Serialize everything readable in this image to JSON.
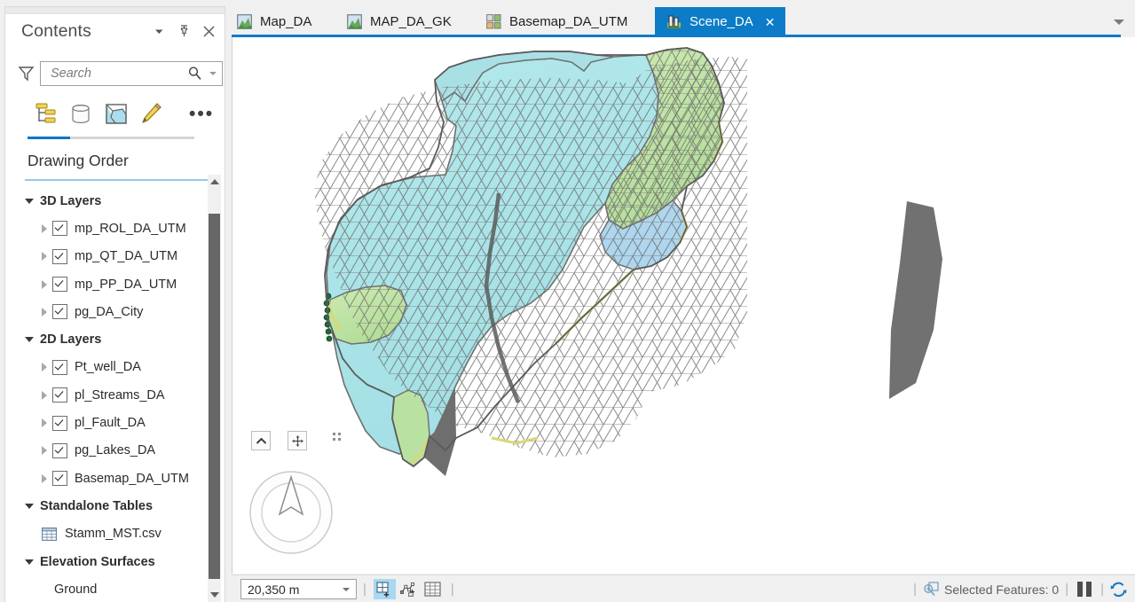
{
  "contents_pane": {
    "title": "Contents",
    "header_buttons": [
      {
        "name": "menu-caret-icon",
        "glyph": "caret-down"
      },
      {
        "name": "pin-icon",
        "glyph": "pin"
      },
      {
        "name": "close-icon",
        "glyph": "close"
      }
    ],
    "search": {
      "placeholder": "Search",
      "value": "",
      "filter_icon": "filter-funnel-icon",
      "magnifier_icon": "search-icon",
      "dropdown_icon": "chevron-down-icon"
    },
    "view_tabs": [
      {
        "name": "list-by-drawing-order-icon",
        "label": "List By Drawing Order",
        "active": true
      },
      {
        "name": "list-by-data-source-icon",
        "label": "List By Data Source",
        "active": false
      },
      {
        "name": "list-by-selection-icon",
        "label": "List By Selection",
        "active": false
      },
      {
        "name": "list-by-editing-icon",
        "label": "List By Editing",
        "active": false
      },
      {
        "name": "more-options-icon",
        "label": "•••",
        "active": false
      }
    ],
    "section_title": "Drawing Order",
    "tree": [
      {
        "type": "group",
        "label": "3D Layers",
        "expanded": true
      },
      {
        "type": "layer",
        "label": "mp_ROL_DA_UTM",
        "checked": true
      },
      {
        "type": "layer",
        "label": "mp_QT_DA_UTM",
        "checked": true
      },
      {
        "type": "layer",
        "label": "mp_PP_DA_UTM",
        "checked": true
      },
      {
        "type": "layer",
        "label": "pg_DA_City",
        "checked": true
      },
      {
        "type": "group",
        "label": "2D Layers",
        "expanded": true
      },
      {
        "type": "layer",
        "label": "Pt_well_DA",
        "checked": true
      },
      {
        "type": "layer",
        "label": "pl_Streams_DA",
        "checked": true
      },
      {
        "type": "layer",
        "label": "pl_Fault_DA",
        "checked": true
      },
      {
        "type": "layer",
        "label": "pg_Lakes_DA",
        "checked": true
      },
      {
        "type": "layer",
        "label": "Basemap_DA_UTM",
        "checked": true
      },
      {
        "type": "group",
        "label": "Standalone Tables",
        "expanded": true
      },
      {
        "type": "table",
        "label": "Stamm_MST.csv"
      },
      {
        "type": "group",
        "label": "Elevation Surfaces",
        "expanded": true
      },
      {
        "type": "plain",
        "label": "Ground"
      }
    ]
  },
  "tabbar": {
    "tabs": [
      {
        "label": "Map_DA",
        "icon": "map-view-icon",
        "active": false,
        "closable": false
      },
      {
        "label": "MAP_DA_GK",
        "icon": "map-view-icon",
        "active": false,
        "closable": false
      },
      {
        "label": "Basemap_DA_UTM",
        "icon": "basemap-view-icon",
        "active": false,
        "closable": false
      },
      {
        "label": "Scene_DA",
        "icon": "scene-view-icon",
        "active": true,
        "closable": true,
        "close_glyph": "✕"
      }
    ],
    "overflow_icon": "tab-overflow-caret-icon",
    "accent_color": "#0c7cc8"
  },
  "map": {
    "name": "scene-3d-view",
    "description": "3D triangulated geological multipatch surface model",
    "colors": {
      "mesh_cyan": "#a9e4e7",
      "mesh_green": "#bde3a4",
      "mesh_blue": "#a9d2ec",
      "mesh_edge": "#6b6b6b",
      "side_wall": "#6e6e6e",
      "yellow_rim": "#d9d97a",
      "background": "#ffffff",
      "well_point": "#1f6b3c"
    },
    "nav": {
      "collapse_button": "collapse-navigator-button",
      "collapse_glyph": "chevron-up-icon",
      "pan_button": "full-control-navigator-button",
      "pan_glyph": "four-way-arrow-icon",
      "grip": "navigator-drag-grip",
      "navigator": "scene-navigator-compass",
      "north_arrow": "north-arrow-icon"
    }
  },
  "statusbar": {
    "scale": "20,350 m",
    "scale_caret": "chevron-down-icon",
    "buttons": [
      {
        "name": "add-selected-to-view-icon",
        "selected": true
      },
      {
        "name": "edit-vertices-icon",
        "selected": false
      },
      {
        "name": "attribute-table-icon",
        "selected": false
      }
    ],
    "selected_features_label": "Selected Features: 0",
    "selected_features_icon": "select-features-icon",
    "pause_drawing_icon": "pause-drawing-icon",
    "refresh_icon": "refresh-icon",
    "refresh_color": "#0e7ac4"
  }
}
